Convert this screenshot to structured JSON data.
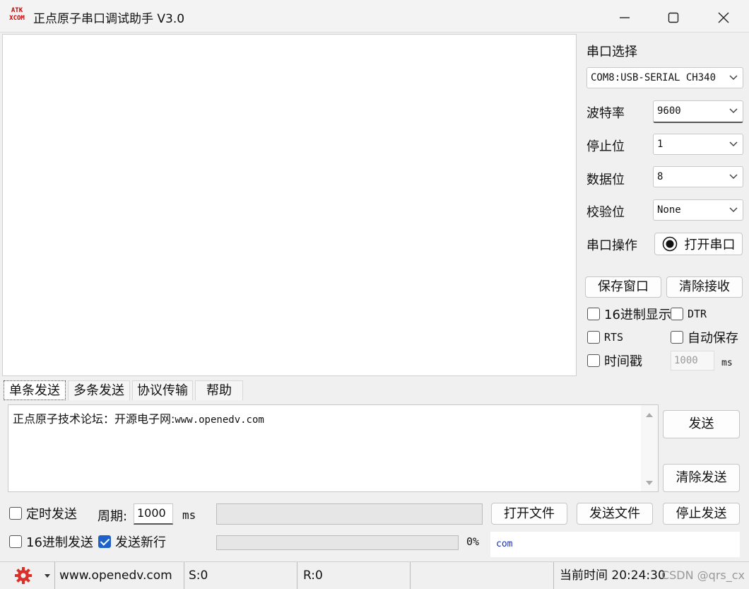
{
  "window": {
    "logo_top": "ATK",
    "logo_bottom": "XCOM",
    "title": "正点原子串口调试助手 V3.0"
  },
  "serial": {
    "section_label": "串口选择",
    "port_value": "COM8:USB-SERIAL CH340",
    "baud_label": "波特率",
    "baud_value": "9600",
    "stop_label": "停止位",
    "stop_value": "1",
    "data_label": "数据位",
    "data_value": "8",
    "parity_label": "校验位",
    "parity_value": "None",
    "op_label": "串口操作",
    "open_button": "打开串口"
  },
  "receive": {
    "save_button": "保存窗口",
    "clear_button": "清除接收",
    "hex_display": "16进制显示",
    "dtr": "DTR",
    "rts": "RTS",
    "auto_save": "自动保存",
    "timestamp": "时间戳",
    "timestamp_value": "1000",
    "ms": "ms"
  },
  "tabs": [
    "单条发送",
    "多条发送",
    "协议传输",
    "帮助"
  ],
  "send": {
    "text_prefix": "正点原子技术论坛：开源电子网:",
    "text_url": "www.openedv.com",
    "send_button": "发送",
    "clear_send_button": "清除发送",
    "timed_send": "定时发送",
    "period_label": "周期:",
    "period_value": "1000",
    "ms": "ms",
    "open_file": "打开文件",
    "send_file": "发送文件",
    "stop_send": "停止发送",
    "hex_send": "16进制发送",
    "send_newline": "发送新行",
    "progress_percent": "0%",
    "com_text": "com"
  },
  "statusbar": {
    "website": "www.openedv.com",
    "sent": "S:0",
    "received": "R:0",
    "time": "当前时间 20:24:30",
    "watermark": "CSDN @qrs_cx"
  }
}
